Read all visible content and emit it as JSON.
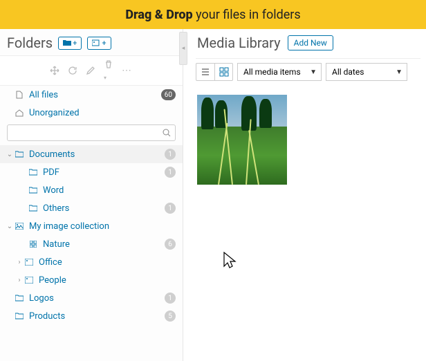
{
  "banner": {
    "bold": "Drag & Drop",
    "rest": " your files in folders"
  },
  "folders": {
    "title": "Folders",
    "btn_new_folder": "+",
    "btn_new_gallery": "+",
    "search_placeholder": "",
    "rows": {
      "all_files": {
        "label": "All files",
        "count": "60"
      },
      "unorganized": {
        "label": "Unorganized"
      },
      "documents": {
        "label": "Documents",
        "count": "1"
      },
      "pdf": {
        "label": "PDF",
        "count": "1"
      },
      "word": {
        "label": "Word"
      },
      "others": {
        "label": "Others",
        "count": "1"
      },
      "my_images": {
        "label": "My image collection"
      },
      "nature": {
        "label": "Nature",
        "count": "6"
      },
      "office": {
        "label": "Office"
      },
      "people": {
        "label": "People"
      },
      "logos": {
        "label": "Logos",
        "count": "1"
      },
      "products": {
        "label": "Products",
        "count": "5"
      }
    }
  },
  "library": {
    "title": "Media Library",
    "add_new": "Add New",
    "filter_type": "All media items",
    "filter_date": "All dates"
  }
}
